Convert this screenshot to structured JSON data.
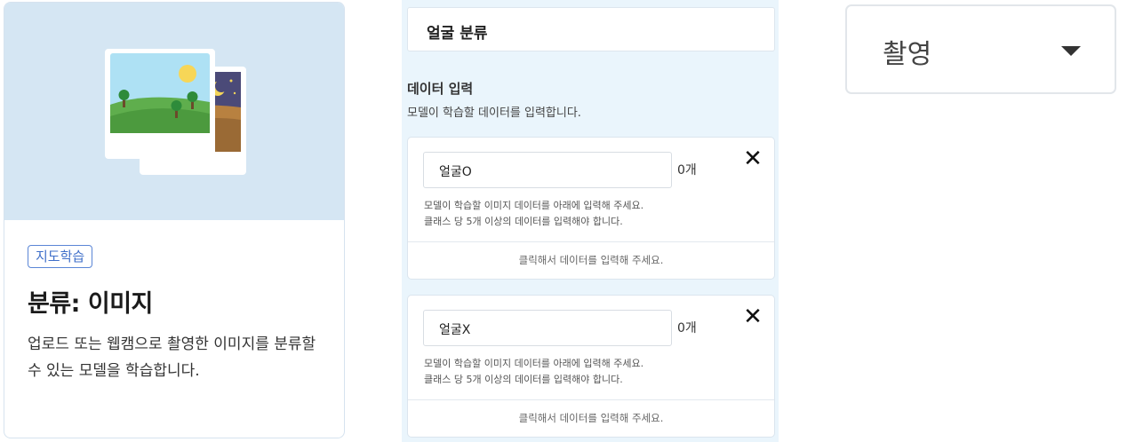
{
  "model_card": {
    "badge": "지도학습",
    "title": "분류: 이미지",
    "description": "업로드 또는 웹캠으로 촬영한 이미지를 분류할 수 있는 모델을 학습합니다.",
    "hero_color": "#d5e6f3"
  },
  "project": {
    "title_value": "얼굴 분류",
    "data_section_title": "데이터 입력",
    "data_section_subtitle": "모델이 학습할 데이터를 입력합니다."
  },
  "classes": [
    {
      "name": "얼굴O",
      "count": "0개",
      "help_line1": "모델이 학습할 이미지 데이터를 아래에 입력해 주세요.",
      "help_line2": "클래스 당 5개 이상의 데이터를 입력해야 합니다.",
      "drop_label": "클릭해서 데이터를 입력해 주세요."
    },
    {
      "name": "얼굴X",
      "count": "0개",
      "help_line1": "모델이 학습할 이미지 데이터를 아래에 입력해 주세요.",
      "help_line2": "클래스 당 5개 이상의 데이터를 입력해야 합니다.",
      "drop_label": "클릭해서 데이터를 입력해 주세요."
    }
  ],
  "close_icon": "✕",
  "source_select": {
    "value": "촬영"
  }
}
